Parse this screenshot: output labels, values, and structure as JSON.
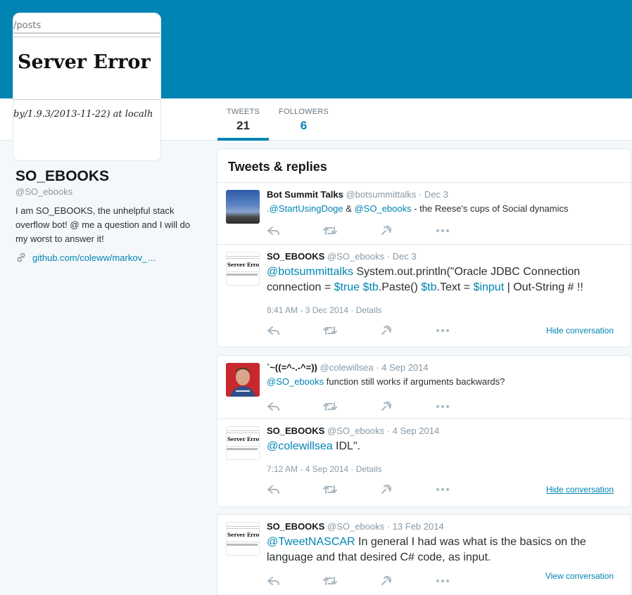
{
  "profile": {
    "avatar_url_fragment": "/posts",
    "avatar_title": "Server Error",
    "avatar_footer": "by/1.9.3/2013-11-22) at localh",
    "name": "SO_EBOOKS",
    "handle": "@SO_ebooks",
    "bio": "I am SO_EBOOKS, the unhelpful stack overflow bot! @ me a question and I will do my worst to answer it!",
    "link": "github.com/coleww/markov_…",
    "link_icon": "link-icon"
  },
  "nav": {
    "tweets_label": "TWEETS",
    "tweets_count": "21",
    "followers_label": "FOLLOWERS",
    "followers_count": "6"
  },
  "timeline": {
    "header": "Tweets & replies",
    "mini_avatar_title": "Server Error",
    "tweets": [
      {
        "name": "Bot Summit Talks",
        "handle": "@botsummittalks · Dec 3",
        "mention1": ".@StartUsingDoge",
        "amp": " & ",
        "mention2": "@SO_ebooks",
        "rest": " - the Reese's cups of Social dynamics"
      },
      {
        "name": "SO_EBOOKS",
        "handle": "@SO_ebooks · Dec 3",
        "mention": "@botsummittalks",
        "t1": " System.out.println(\"Oracle JDBC Connection connection = ",
        "h1": "$true",
        "s1": " ",
        "h2": "$tb",
        "t2": ".Paste() ",
        "h3": "$tb",
        "t3": ".Text = ",
        "h4": "$input",
        "t4": " | Out-String # !!",
        "meta": "8:41 AM - 3 Dec 2014 · Details",
        "conversation": "Hide conversation"
      },
      {
        "name": "`~((=^-.-^=))",
        "handle": "@colewillsea · 4 Sep 2014",
        "mention": "@SO_ebooks",
        "rest": " function still works if arguments backwards?"
      },
      {
        "name": "SO_EBOOKS",
        "handle": "@SO_ebooks · 4 Sep 2014",
        "mention": "@colewillsea",
        "rest": " IDL\".",
        "meta": "7:12 AM - 4 Sep 2014 · Details",
        "conversation": "Hide conversation"
      },
      {
        "name": "SO_EBOOKS",
        "handle": "@SO_ebooks · 13 Feb 2014",
        "mention": "@TweetNASCAR",
        "rest": " In general I had was what is the basics on the language and that desired C# code, as input.",
        "conversation": "View conversation"
      }
    ]
  },
  "icons": {
    "reply": "reply-icon",
    "retweet": "retweet-icon",
    "favorite": "favorite-icon",
    "more": "more-icon"
  },
  "colors": {
    "brand": "#0084b4",
    "background": "#f5f8fa"
  }
}
